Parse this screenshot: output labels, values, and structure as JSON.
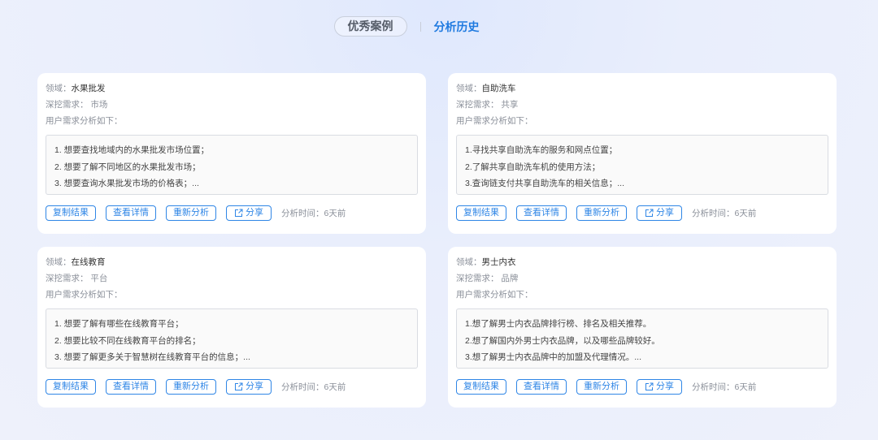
{
  "tabs": {
    "cases": "优秀案例",
    "history": "分析历史"
  },
  "labels": {
    "field": "领域：",
    "demand": "深挖需求：",
    "analysis": "用户需求分析如下：",
    "copy": "复制结果",
    "detail": "查看详情",
    "reanalyze": "重新分析",
    "share": "分享",
    "time_label": "分析时间：",
    "share_icon": "share-icon"
  },
  "cards": [
    {
      "field": "水果批发",
      "demand": "市场",
      "items": [
        "1. 想要查找地域内的水果批发市场位置；",
        "2. 想要了解不同地区的水果批发市场；",
        "3. 想要查询水果批发市场的价格表；..."
      ],
      "time": "6天前"
    },
    {
      "field": "自助洗车",
      "demand": "共享",
      "items": [
        "1.寻找共享自助洗车的服务和网点位置；",
        "2.了解共享自助洗车机的使用方法；",
        "3.查询链支付共享自助洗车的相关信息；..."
      ],
      "time": "6天前"
    },
    {
      "field": "在线教育",
      "demand": "平台",
      "items": [
        "1. 想要了解有哪些在线教育平台；",
        "2. 想要比较不同在线教育平台的排名；",
        "3. 想要了解更多关于智慧树在线教育平台的信息；..."
      ],
      "time": "6天前"
    },
    {
      "field": "男士内衣",
      "demand": "品牌",
      "items": [
        "1.想了解男士内衣品牌排行榜、排名及相关推荐。",
        "2.想了解国内外男士内衣品牌，以及哪些品牌较好。",
        "3.想了解男士内衣品牌中的加盟及代理情况。..."
      ],
      "time": "6天前"
    }
  ]
}
